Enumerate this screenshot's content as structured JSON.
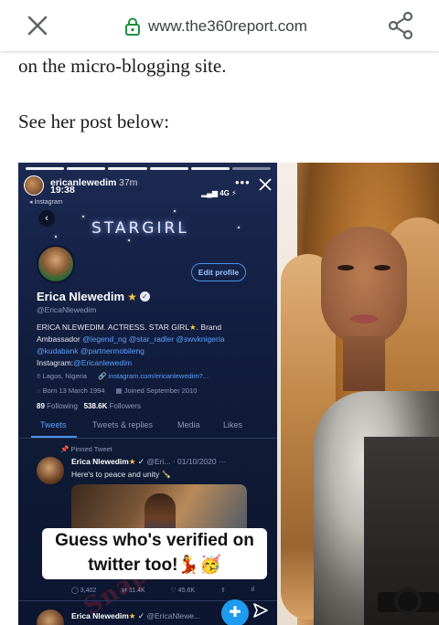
{
  "browser": {
    "url": "www.the360report.com",
    "close_icon": "close-icon",
    "lock_icon": "lock-icon",
    "share_icon": "share-icon",
    "lock_color": "#1e8e3e"
  },
  "article": {
    "line1": "on the micro-blogging site.",
    "line2": "See her post below:"
  },
  "embed": {
    "story": {
      "username": "ericanlewedim",
      "posted": "37m",
      "clock": "19:38",
      "source": "◂ Instagram",
      "signal": "4G"
    },
    "banner_text": "STARGIRL",
    "edit_profile": "Edit profile",
    "profile": {
      "name": "Erica Nlewedim",
      "handle": "@EricaNlewedim",
      "bio_line1": "ERICA NLEWEDIM. ACTRESS. STAR GIRL",
      "bio_line1_end": ". Brand",
      "bio_line2_start": "Ambassador ",
      "bio_links_line2": "@legend_ng @star_radler @swvknigeria",
      "bio_links_line3": "@kudabank @partnermobileng",
      "bio_line4_start": "Instagram:",
      "bio_line4_link": "@Ericanlewedim",
      "location": "Lagos, Nigeria",
      "website": "instagram.com/ericanlewedim?...",
      "born": "Born 13 March 1994",
      "joined": "Joined September 2010",
      "following_count": "89",
      "following_label": "Following",
      "followers_count": "538.6K",
      "followers_label": "Followers"
    },
    "tabs": [
      "Tweets",
      "Tweets & replies",
      "Media",
      "Likes"
    ],
    "pinned_label": "Pinned Tweet",
    "tweet": {
      "name": "Erica Nlewedim",
      "handle": "@Eri...",
      "date": "· 01/10/2020",
      "text": "Here's to peace and unity 🍾",
      "replies": "3,402",
      "retweets": "11.4K",
      "likes": "45.6K"
    },
    "caption_line1": "Guess who's verified on",
    "caption_line2": "twitter too!💃🥳",
    "watermark": "SnapRadio",
    "next_tweet": {
      "name": "Erica Nlewedim",
      "handle": "@EricaNlewe..."
    }
  }
}
